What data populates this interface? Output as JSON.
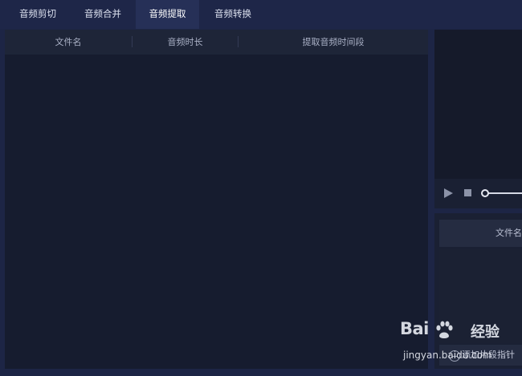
{
  "tabs": [
    {
      "label": "音频剪切",
      "active": false
    },
    {
      "label": "音频合并",
      "active": false
    },
    {
      "label": "音频提取",
      "active": true
    },
    {
      "label": "音频转换",
      "active": false
    }
  ],
  "table": {
    "columns": [
      "文件名",
      "音频时长",
      "提取音频时间段"
    ],
    "rows": []
  },
  "player": {
    "play_icon": "play-icon",
    "stop_icon": "stop-icon"
  },
  "segment_panel": {
    "header": "文件名",
    "add_button_label": "添加片段指针",
    "add_icon": "plus-circle-icon"
  },
  "watermark": {
    "brand": "Bai",
    "brand_cn": "经验",
    "url": "jingyan.baidu.com"
  },
  "colors": {
    "background": "#1d2545",
    "panel": "#171d30",
    "active_tab": "#263057"
  }
}
